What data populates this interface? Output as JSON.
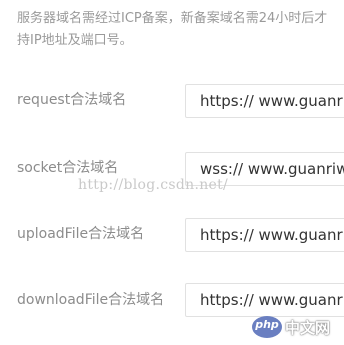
{
  "notice": {
    "line1": "服务器域名需经过ICP备案，新备案域名需24小时后才",
    "line2": "持IP地址及端口号。"
  },
  "domains": [
    {
      "label": "request合法域名",
      "value": "https:// www.guanriwei.com"
    },
    {
      "label": "socket合法域名",
      "value": "wss:// www.guanriwei.com"
    },
    {
      "label": "uploadFile合法域名",
      "value": "https:// www.guanriwei.com"
    },
    {
      "label": "downloadFile合法域名",
      "value": "https:// www.guanriwei.com"
    }
  ],
  "watermark": "http://blog.csdn.net/",
  "logo": {
    "badge": "php",
    "text": "中文网"
  }
}
